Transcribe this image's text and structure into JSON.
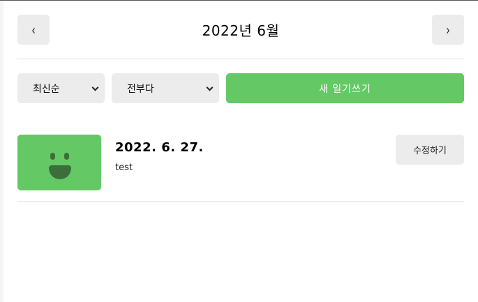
{
  "header": {
    "prev_label": "‹",
    "next_label": "›",
    "title": "2022년 6월"
  },
  "controls": {
    "sort_selected": "최신순",
    "filter_selected": "전부다",
    "new_button_label": "새 일기쓰기"
  },
  "diary_list": [
    {
      "date": "2022. 6. 27.",
      "content": "test",
      "emotion_icon": "happy-face-icon",
      "emotion_color": "#64c964",
      "edit_label": "수정하기"
    }
  ]
}
